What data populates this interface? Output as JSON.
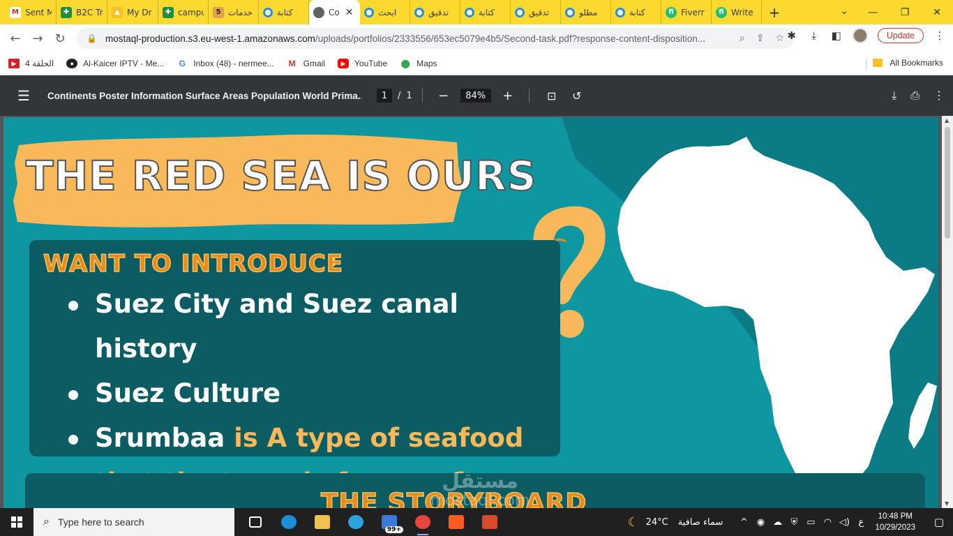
{
  "browser": {
    "tabs": [
      {
        "title": "Sent M",
        "icon": "gmail-icon",
        "fav": "gmail",
        "glyph": "M",
        "active": false,
        "width": 73
      },
      {
        "title": "B2C Tr",
        "icon": "sheets-icon",
        "fav": "sheets",
        "glyph": "✚",
        "active": false,
        "width": 73
      },
      {
        "title": "My Dr",
        "icon": "drive-icon",
        "fav": "drive",
        "glyph": "▲",
        "active": false,
        "width": 73
      },
      {
        "title": "campu",
        "icon": "sheets-icon",
        "fav": "sheets",
        "glyph": "✚",
        "active": false,
        "width": 72
      },
      {
        "title": "خدمات",
        "icon": "khamsat-icon",
        "fav": "five",
        "glyph": "5",
        "active": false,
        "width": 72
      },
      {
        "title": "كتابة",
        "icon": "mostaql-icon",
        "fav": "ring",
        "glyph": "",
        "active": false,
        "width": 72
      },
      {
        "title": "Co",
        "icon": "globe-icon",
        "fav": "globe",
        "glyph": "",
        "active": true,
        "width": 73
      },
      {
        "title": "ابحث",
        "icon": "mostaql-icon",
        "fav": "ring",
        "glyph": "",
        "active": false,
        "width": 72
      },
      {
        "title": "تدقيق",
        "icon": "mostaql-icon",
        "fav": "ring",
        "glyph": "",
        "active": false,
        "width": 72
      },
      {
        "title": "كتابة",
        "icon": "mostaql-icon",
        "fav": "ring",
        "glyph": "",
        "active": false,
        "width": 72
      },
      {
        "title": "تدقيق",
        "icon": "mostaql-icon",
        "fav": "ring",
        "glyph": "",
        "active": false,
        "width": 72
      },
      {
        "title": "مطلو",
        "icon": "mostaql-icon",
        "fav": "ring",
        "glyph": "",
        "active": false,
        "width": 72
      },
      {
        "title": "كتابة",
        "icon": "mostaql-icon",
        "fav": "ring",
        "glyph": "",
        "active": false,
        "width": 72
      },
      {
        "title": "Fiverr",
        "icon": "fiverr-icon",
        "fav": "fiverr",
        "glyph": "fi",
        "active": false,
        "width": 72
      },
      {
        "title": "Write",
        "icon": "fiverr-icon",
        "fav": "fiverr",
        "glyph": "fi",
        "active": false,
        "width": 72
      }
    ],
    "url_host": "mostaql-production.s3.eu-west-1.amazonaws.com",
    "url_path": "/uploads/portfolios/2333556/653ec5079e4b5/Second-task.pdf?response-content-disposition...",
    "update_label": "Update",
    "bookmarks": [
      {
        "label": "الحلقة 4",
        "icon": "tv-icon",
        "style": "red",
        "glyph": "▶"
      },
      {
        "label": "Al-Kaicer IPTV - Me...",
        "icon": "iptv-icon",
        "style": "dark",
        "glyph": "●"
      },
      {
        "label": "Inbox (48) - nermee...",
        "icon": "google-icon",
        "style": "goog",
        "glyph": "G"
      },
      {
        "label": "Gmail",
        "icon": "gmail-icon",
        "style": "gm",
        "glyph": "M"
      },
      {
        "label": "YouTube",
        "icon": "youtube-icon",
        "style": "yt",
        "glyph": "▶"
      },
      {
        "label": "Maps",
        "icon": "maps-icon",
        "style": "maps",
        "glyph": "⬤"
      }
    ],
    "all_bookmarks_label": "All Bookmarks"
  },
  "pdf": {
    "title": "Continents Poster Information Surface Areas Population World Prima...",
    "page_current": "1",
    "page_sep": "/",
    "page_total": "1",
    "zoom": "84%"
  },
  "poster": {
    "title": "THE RED SEA IS OURS",
    "intro_heading": "WANT TO INTRODUCE",
    "intro_colon": ":",
    "bullets": [
      {
        "white": "Suez City and  Suez canal history",
        "orange": ""
      },
      {
        "white": "Suez Culture",
        "orange": ""
      },
      {
        "white": "Srumbaa ",
        "orange": "is A type of seafood  that the town is famous for"
      }
    ],
    "storyboard_heading": "THE STORYBOARD",
    "watermark_ar": "مستقل",
    "watermark_lat": "mostaql.com",
    "colors": {
      "background": "#0f97a1",
      "dark_panel": "#0c5c63",
      "orange": "#f9b85a",
      "map_white": "#ffffff"
    }
  },
  "taskbar": {
    "search_placeholder": "Type here to search",
    "apps": [
      {
        "name": "task-view-icon",
        "color": "#ffffff",
        "running": false
      },
      {
        "name": "edge-icon",
        "color": "#1a8fd8",
        "running": false
      },
      {
        "name": "file-explorer-icon",
        "color": "#f2c14e",
        "running": false
      },
      {
        "name": "telegram-icon",
        "color": "#2aa3e0",
        "running": false
      },
      {
        "name": "mail-icon",
        "color": "#3b7ad8",
        "running": false
      },
      {
        "name": "chrome-icon",
        "color": "#e8453c",
        "running": true
      },
      {
        "name": "brave-icon",
        "color": "#ff5a1f",
        "running": false
      },
      {
        "name": "office-icon",
        "color": "#d84a2a",
        "running": false
      }
    ],
    "mail_badge": "99+",
    "weather_temp": "24°C",
    "weather_desc": "سماء صافية",
    "time": "10:48 PM",
    "date": "10/29/2023",
    "lang": "ع"
  }
}
